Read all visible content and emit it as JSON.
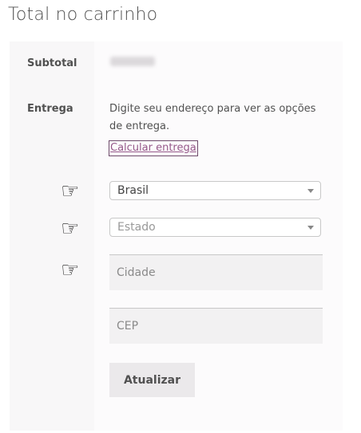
{
  "cart": {
    "title": "Total no carrinho",
    "subtotal_label": "Subtotal",
    "shipping_label": "Entrega",
    "shipping_description": "Digite seu endereço para ver as opções de entrega.",
    "calculate_link": "Calcular entrega"
  },
  "form": {
    "country": {
      "selected": "Brasil",
      "icon": "chevron-down-icon"
    },
    "state": {
      "placeholder": "Estado",
      "icon": "chevron-down-icon"
    },
    "city": {
      "placeholder": "Cidade"
    },
    "postcode": {
      "placeholder": "CEP"
    },
    "update_button": "Atualizar"
  },
  "annotations": {
    "pointer_glyph": "☞",
    "pointer_icon": "pointing-hand-icon"
  },
  "colors": {
    "link": "#96588a",
    "panel_bg": "#fcfbfc",
    "button_bg": "#ebe9eb"
  }
}
